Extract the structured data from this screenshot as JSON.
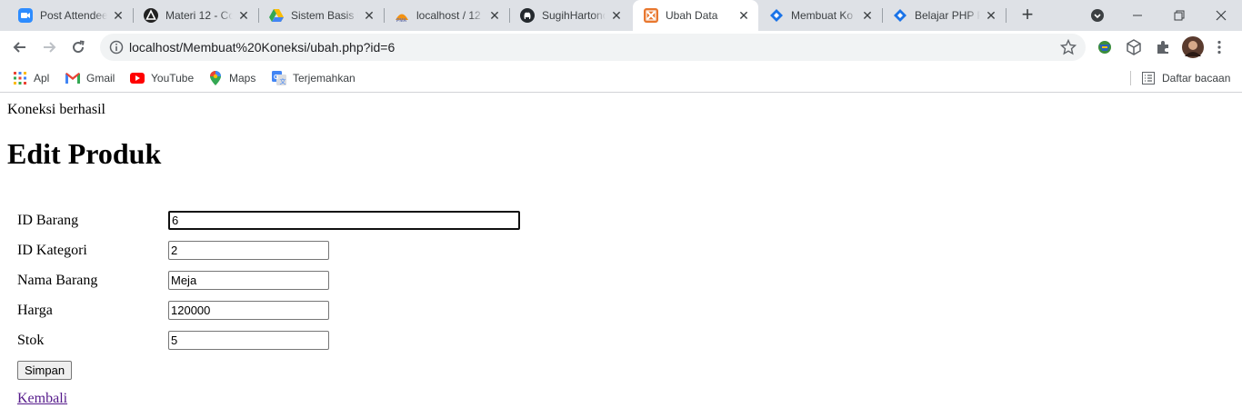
{
  "tabs": [
    {
      "title": "Post Attendee",
      "icon": "zoom-icon"
    },
    {
      "title": "Materi 12 - Co",
      "icon": "triangle-app-icon"
    },
    {
      "title": "Sistem Basis D",
      "icon": "google-drive-icon"
    },
    {
      "title": "localhost / 12",
      "icon": "phpmyadmin-icon"
    },
    {
      "title": "SugihHartono",
      "icon": "github-icon"
    },
    {
      "title": "Ubah Data",
      "icon": "xampp-icon"
    },
    {
      "title": "Membuat Ko",
      "icon": "code-diamond-icon"
    },
    {
      "title": "Belajar PHP Pe",
      "icon": "code-diamond-icon"
    }
  ],
  "address": {
    "url": "localhost/Membuat%20Koneksi/ubah.php?id=6"
  },
  "bookmarks": {
    "items": [
      {
        "label": "Apl",
        "icon": "apps-grid-icon"
      },
      {
        "label": "Gmail",
        "icon": "gmail-icon"
      },
      {
        "label": "YouTube",
        "icon": "youtube-icon"
      },
      {
        "label": "Maps",
        "icon": "maps-pin-icon"
      },
      {
        "label": "Terjemahkan",
        "icon": "translate-icon"
      }
    ],
    "reading_list": "Daftar bacaan"
  },
  "page": {
    "status": "Koneksi berhasil",
    "heading": "Edit Produk",
    "fields": [
      {
        "label": "ID Barang",
        "value": "6"
      },
      {
        "label": "ID Kategori",
        "value": "2"
      },
      {
        "label": "Nama Barang",
        "value": "Meja"
      },
      {
        "label": "Harga",
        "value": "120000"
      },
      {
        "label": "Stok",
        "value": "5"
      }
    ],
    "save_button": "Simpan",
    "back_link": "Kembali"
  },
  "colors": {
    "tabstrip": "#dee1e6",
    "link_visited": "#551a8b",
    "xampp": "#e8772e",
    "code_blue": "#1a73e8"
  }
}
